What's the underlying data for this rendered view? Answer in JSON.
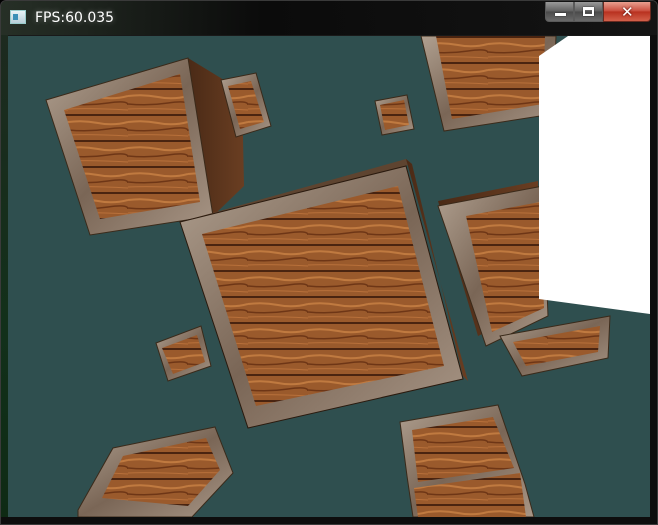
{
  "window": {
    "title": "FPS:60.035",
    "icon": "app-window-icon",
    "controls": {
      "minimize_icon": "minimize-icon",
      "maximize_icon": "maximize-icon",
      "close_icon": "close-icon",
      "close_glyph": "✕"
    }
  },
  "scene": {
    "background_color": "#2f4f4f",
    "crate_wood_color": "#9a5a2c",
    "crate_frame_color": "#8c7a6a",
    "plane_color": "#ffffff"
  }
}
